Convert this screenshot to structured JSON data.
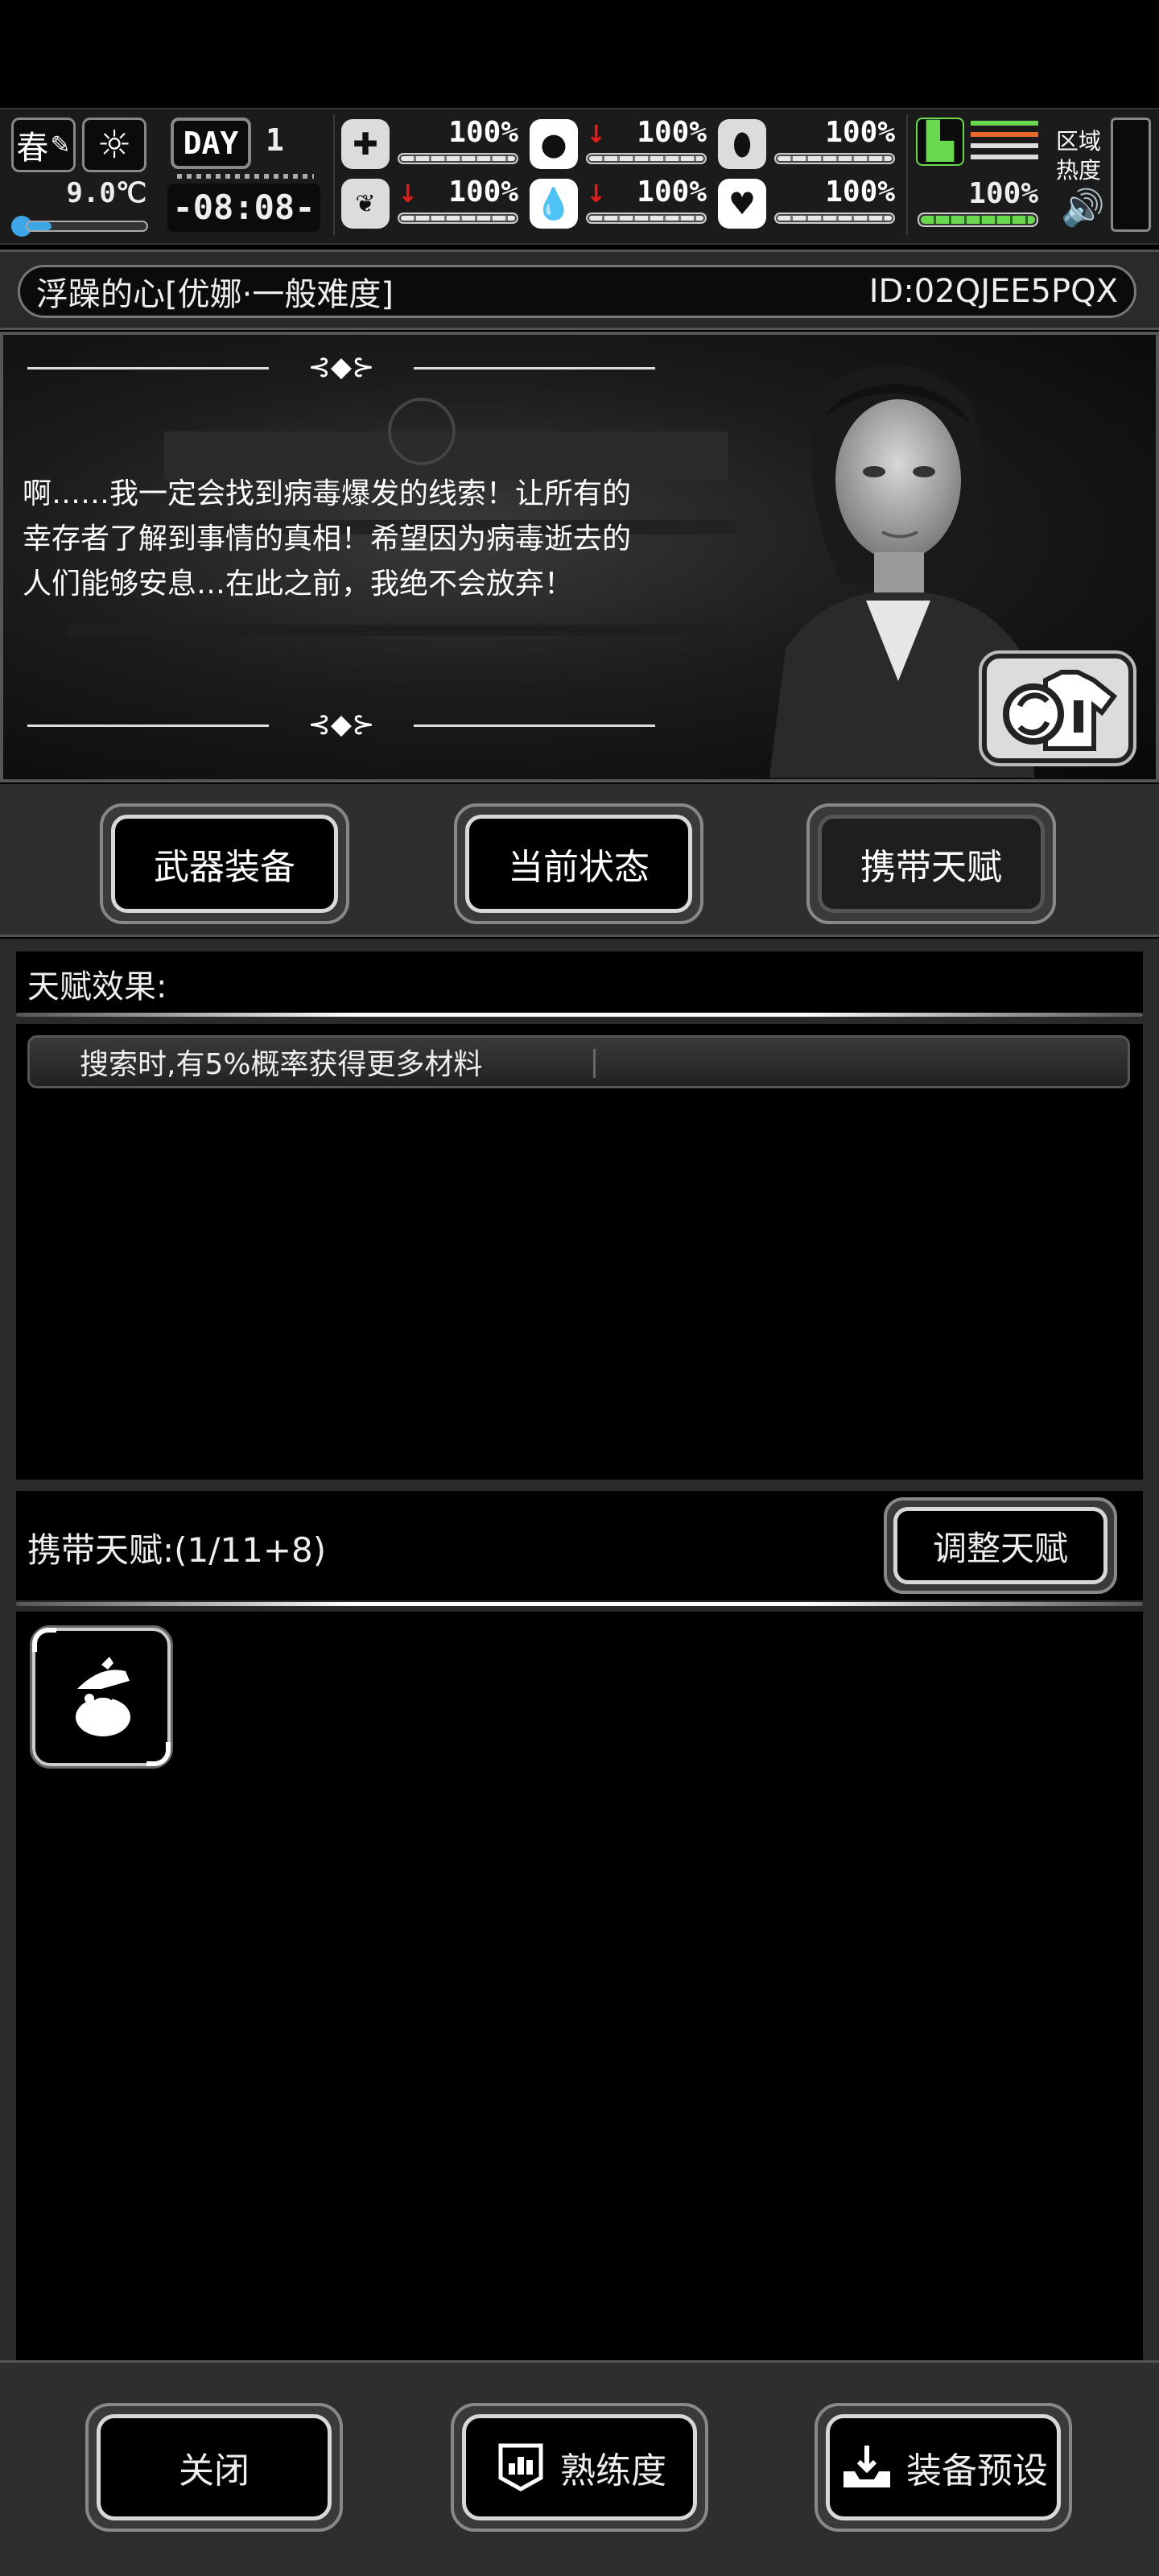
{
  "hud": {
    "season": "春",
    "temperature": "9.0℃",
    "day_label": "DAY",
    "day_number": "1",
    "time": "-08:08-",
    "stats": [
      {
        "icon": "first-aid-icon",
        "value": "100%",
        "trend_down": false,
        "fill": 1.0
      },
      {
        "icon": "stomach-icon",
        "value": "100%",
        "trend_down": true,
        "fill": 1.0
      },
      {
        "icon": "pill-icon",
        "value": "100%",
        "trend_down": false,
        "fill": 1.0
      },
      {
        "icon": "brain-icon",
        "value": "100%",
        "trend_down": true,
        "fill": 1.0
      },
      {
        "icon": "water-drop-icon",
        "value": "100%",
        "trend_down": true,
        "fill": 1.0
      },
      {
        "icon": "heart-icon",
        "value": "100%",
        "trend_down": false,
        "fill": 1.0
      }
    ],
    "stamina_value": "100%",
    "zone_heat_label": "区域热度",
    "accent_green": "#6bd94f",
    "warning_red": "#e21b1b",
    "alert_orange": "#e8692b"
  },
  "title_bar": {
    "title": "浮躁的心[优娜·一般难度]",
    "id": "ID:02QJEE5PQX"
  },
  "story": {
    "text": "啊……我一定会找到病毒爆发的线索！让所有的幸存者了解到事情的真相！希望因为病毒逝去的人们能够安息…在此之前，我绝不会放弃！"
  },
  "tabs": [
    {
      "label": "武器装备",
      "active": false
    },
    {
      "label": "当前状态",
      "active": false
    },
    {
      "label": "携带天赋",
      "active": true
    }
  ],
  "talent_effect": {
    "header": "天赋效果:",
    "items": [
      "搜索时,有5%概率获得更多材料"
    ]
  },
  "carried_talents": {
    "label": "携带天赋:(1/11+8)",
    "adjust_button": "调整天赋",
    "slots": [
      {
        "icon": "scavenge-hand-bag-icon"
      }
    ]
  },
  "bottom_bar": {
    "close": "关闭",
    "proficiency": "熟练度",
    "preset": "装备预设"
  }
}
